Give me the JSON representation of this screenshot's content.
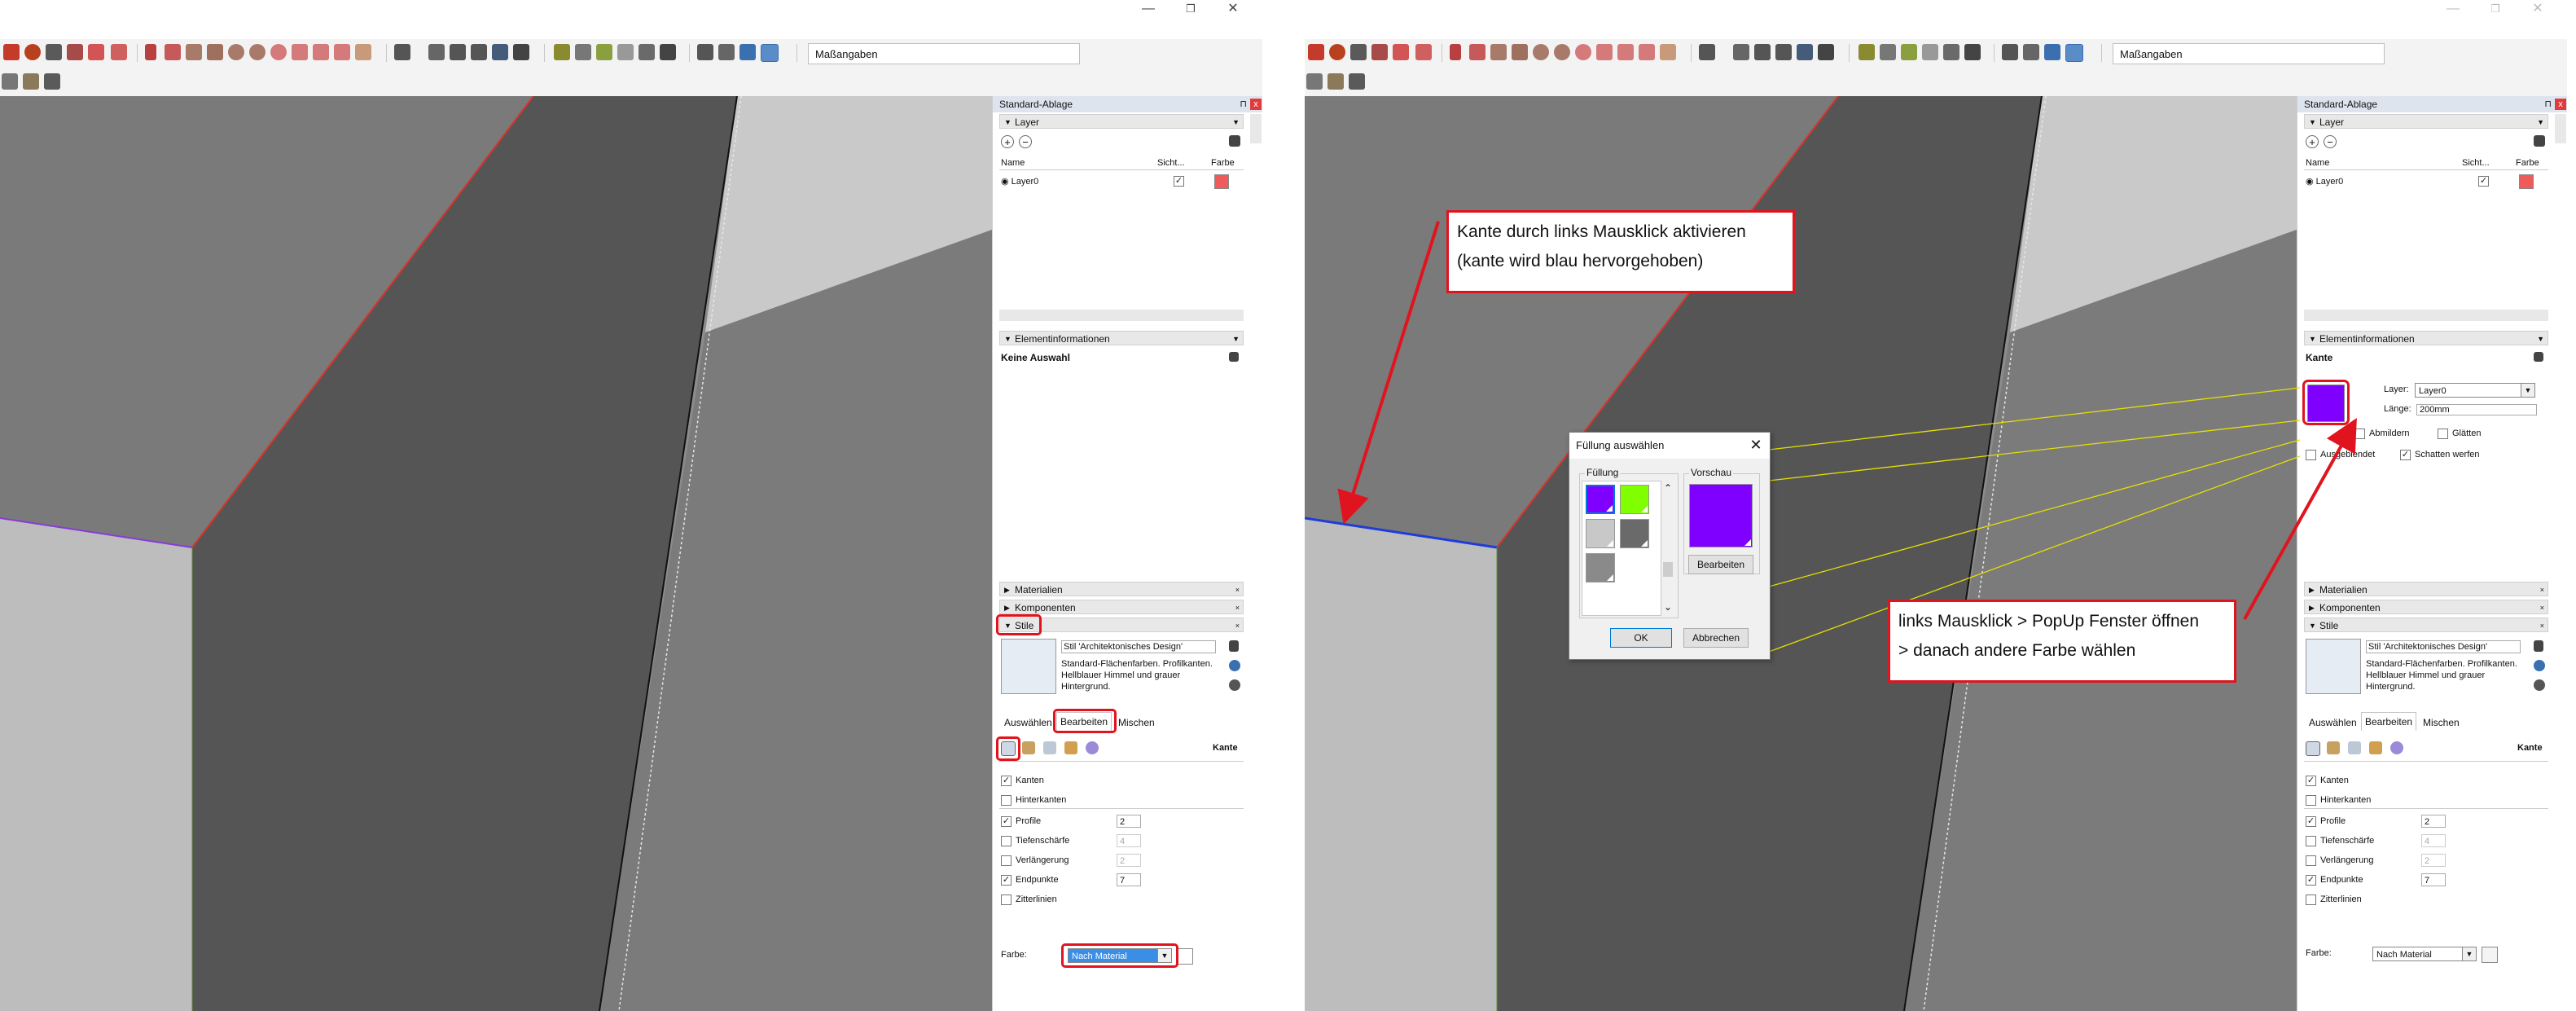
{
  "window_controls": {
    "minimize": "—",
    "maximize": "❐",
    "close": "✕"
  },
  "toolbar": {
    "measurements_label": "Maßangaben"
  },
  "tray": {
    "title": "Standard-Ablage",
    "close": "x",
    "pin": "⊓",
    "layer_section": "Layer",
    "layer_columns": {
      "name": "Name",
      "visible": "Sicht...",
      "color": "Farbe"
    },
    "layers": [
      {
        "name": "Layer0",
        "visible": "✓",
        "color": "#ef5b5b"
      }
    ],
    "entity_info_section": "Elementinformationen",
    "materials_section": "Materialien",
    "components_section": "Komponenten",
    "styles_section": "Stile",
    "style_name": "Stil 'Architektonisches Design'",
    "style_description": "Standard-Flächenfarben. Profilkanten. Hellblauer Himmel und grauer Hintergrund.",
    "style_tabs": [
      "Auswählen",
      "Bearbeiten",
      "Mischen"
    ],
    "edge_settings_title": "Kante",
    "edge_options": [
      {
        "label": "Kanten",
        "checked": "✓",
        "value": ""
      },
      {
        "label": "Hinterkanten",
        "checked": "",
        "value": ""
      },
      {
        "label": "Profile",
        "checked": "✓",
        "value": "2"
      },
      {
        "label": "Tiefenschärfe",
        "checked": "",
        "value": "4"
      },
      {
        "label": "Verlängerung",
        "checked": "",
        "value": "2"
      },
      {
        "label": "Endpunkte",
        "checked": "✓",
        "value": "7"
      },
      {
        "label": "Zitterlinien",
        "checked": "",
        "value": ""
      }
    ],
    "color_label": "Farbe:",
    "color_value": "Nach Material"
  },
  "left": {
    "entity_info_text": "Keine Auswahl"
  },
  "right": {
    "entity_type": "Kante",
    "entity_layer_label": "Layer:",
    "entity_layer_value": "Layer0",
    "entity_length_label": "Länge:",
    "entity_length_value": "200mm",
    "soften_label": "Abmildern",
    "smooth_label": "Glätten",
    "hidden_label": "Ausgeblendet",
    "cast_shadow_label": "Schatten werfen",
    "cast_shadow_checked": "✓",
    "edge_color": "#8000ff",
    "callout1_line1": "Kante durch links Mausklick aktivieren",
    "callout1_line2": "(kante wird blau hervorgehoben)",
    "callout2_line1": "links Mausklick > PopUp Fenster öffnen",
    "callout2_line2": "> danach andere Farbe wählen",
    "dialog": {
      "title": "Füllung auswählen",
      "close": "✕",
      "fill_group": "Füllung",
      "preview_group": "Vorschau",
      "swatches": [
        "#8000ff",
        "#80ff00",
        "#c8c8c8",
        "#6a6a6a",
        "#8a8a8a"
      ],
      "preview_color": "#8000ff",
      "edit_button": "Bearbeiten",
      "ok_button": "OK",
      "cancel_button": "Abbrechen",
      "scroll_up": "⌃",
      "scroll_down": "⌄"
    }
  }
}
